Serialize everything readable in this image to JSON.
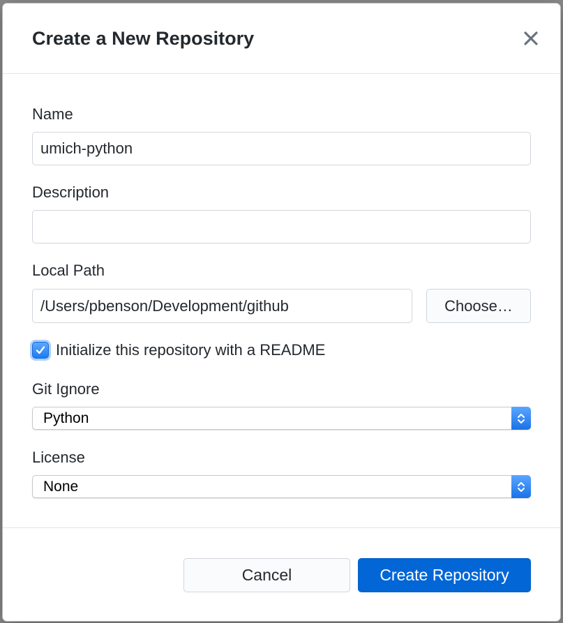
{
  "dialog": {
    "title": "Create a New Repository",
    "close_icon": "close-icon"
  },
  "form": {
    "name": {
      "label": "Name",
      "value": "umich-python"
    },
    "description": {
      "label": "Description",
      "value": ""
    },
    "local_path": {
      "label": "Local Path",
      "value": "/Users/pbenson/Development/github",
      "choose_label": "Choose…"
    },
    "readme": {
      "label": "Initialize this repository with a README",
      "checked": true
    },
    "git_ignore": {
      "label": "Git Ignore",
      "value": "Python"
    },
    "license": {
      "label": "License",
      "value": "None"
    }
  },
  "footer": {
    "cancel_label": "Cancel",
    "create_label": "Create Repository"
  },
  "colors": {
    "primary_button": "#0366d6",
    "checkbox_accent": "#1a7cf0",
    "text": "#24292e",
    "border": "#d1d5da"
  }
}
